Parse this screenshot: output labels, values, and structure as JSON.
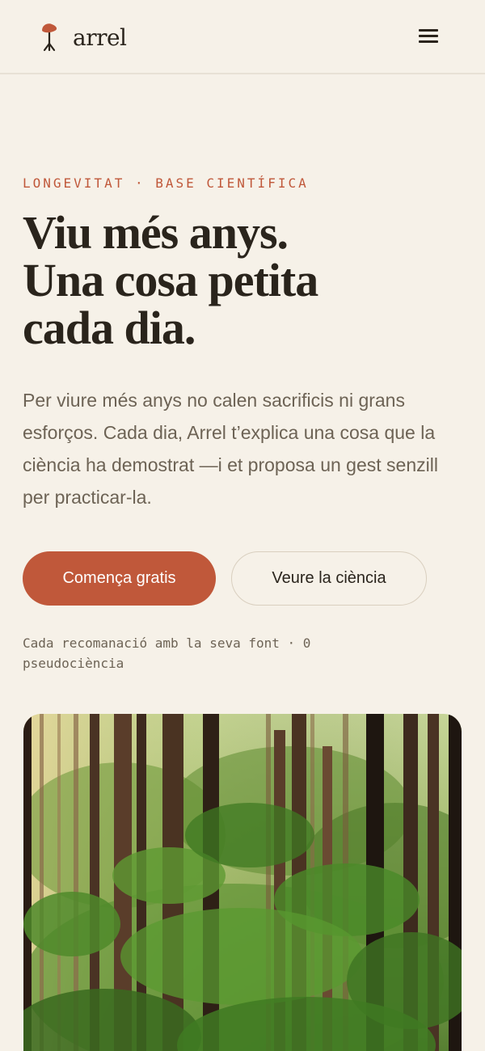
{
  "brand": {
    "name": "arrel",
    "logo_icon": "sprout-icon",
    "accent_color": "#c0583a"
  },
  "header": {
    "menu_icon": "hamburger-menu-icon"
  },
  "hero": {
    "eyebrow": "LONGEVITAT · BASE CIENTÍFICA",
    "headline_lines": [
      "Viu més anys.",
      "Una cosa petita",
      "cada dia."
    ],
    "intro": "Per viure més anys no calen sacrificis ni grans esforços. Cada dia, Arrel t’explica una cosa que la ciència ha demostrat —i et proposa un gest senzill per practicar-la.",
    "primary_cta": "Comença gratis",
    "secondary_cta": "Veure la ciència",
    "trust_note": "Cada recomanació amb la seva font · 0 pseudociència"
  },
  "media": {
    "image_icon": "forest-photo"
  },
  "colors": {
    "background": "#f6f1e8",
    "text": "#2a241c",
    "muted_text": "#6d6355",
    "accent": "#c0583a"
  }
}
